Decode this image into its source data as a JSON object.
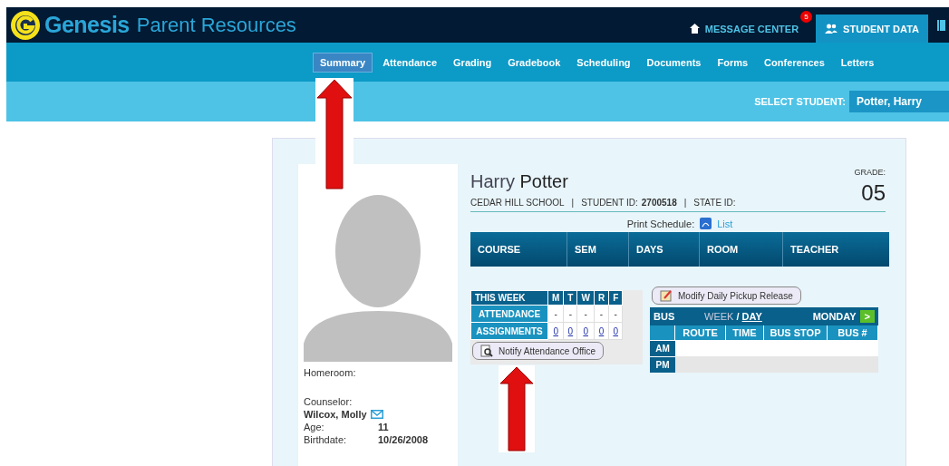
{
  "header": {
    "logo_word": "Genesis",
    "title": "Parent Resources",
    "links": [
      {
        "label": "MESSAGE CENTER",
        "badge": "5",
        "selected": false
      },
      {
        "label": "STUDENT DATA",
        "selected": true
      }
    ]
  },
  "nav": {
    "tabs": [
      {
        "label": "Summary",
        "selected": true
      },
      {
        "label": "Attendance",
        "selected": false
      },
      {
        "label": "Grading",
        "selected": false
      },
      {
        "label": "Gradebook",
        "selected": false
      },
      {
        "label": "Scheduling",
        "selected": false
      },
      {
        "label": "Documents",
        "selected": false
      },
      {
        "label": "Forms",
        "selected": false
      },
      {
        "label": "Conferences",
        "selected": false
      },
      {
        "label": "Letters",
        "selected": false
      }
    ]
  },
  "select_student": {
    "label": "SELECT STUDENT:",
    "value": "Potter, Harry"
  },
  "profile": {
    "homeroom_label": "Homeroom:",
    "counselor_label": "Counselor:",
    "counselor": "Wilcox, Molly",
    "details": [
      {
        "label": "Age:",
        "value": "11"
      },
      {
        "label": "Birthdate:",
        "value": "10/26/2008"
      }
    ]
  },
  "student": {
    "first_name": "Harry",
    "last_name": "Potter",
    "school": "CEDAR HILL SCHOOL",
    "separators": [
      "|",
      "|"
    ],
    "student_id_label": "STUDENT ID:",
    "student_id": "2700518",
    "state_id_label": "STATE ID:",
    "grade_label": "GRADE:",
    "grade": "05"
  },
  "print_schedule": {
    "label": "Print Schedule:",
    "link": "List"
  },
  "schedule": {
    "columns": [
      "COURSE",
      "SEM",
      "DAYS",
      "ROOM",
      "TEACHER"
    ]
  },
  "week": {
    "header": [
      "THIS WEEK",
      "M",
      "T",
      "W",
      "R",
      "F"
    ],
    "rows": [
      {
        "label": "ATTENDANCE",
        "kind": "text",
        "cells": [
          "-",
          "-",
          "-",
          "-",
          "-"
        ]
      },
      {
        "label": "ASSIGNMENTS",
        "kind": "link",
        "cells": [
          "0",
          "0",
          "0",
          "0",
          "0"
        ]
      }
    ]
  },
  "notify_button": "Notify Attendance Office",
  "pickup_button": "Modify Daily Pickup Release",
  "bus": {
    "title": "BUS",
    "week": "WEEK",
    "separator": "/",
    "day": "DAY",
    "day_name": "MONDAY",
    "next": ">",
    "columns": [
      "ROUTE",
      "TIME",
      "BUS STOP",
      "BUS #"
    ],
    "rows": [
      "AM",
      "PM"
    ]
  }
}
